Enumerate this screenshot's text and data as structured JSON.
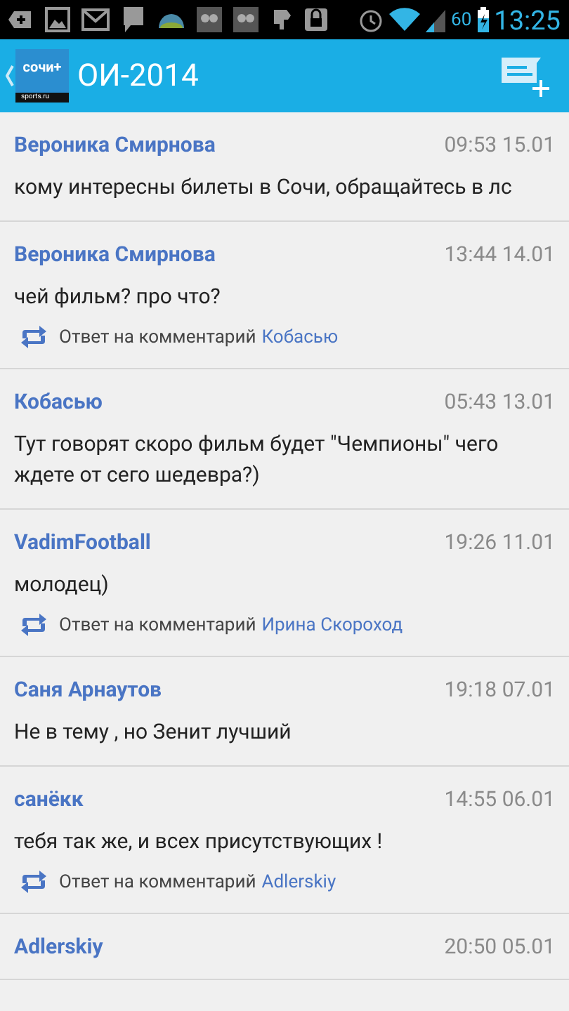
{
  "status_bar": {
    "battery": "60",
    "time": "13:25"
  },
  "app_bar": {
    "logo_text": "сочи+",
    "logo_caption": "sports.ru",
    "title": "ОИ-2014"
  },
  "comments": [
    {
      "author": "Вероника Смирнова",
      "time": "09:53 15.01",
      "text": "кому интересны билеты в Сочи, обращайтесь в лс"
    },
    {
      "author": "Вероника Смирнова",
      "time": "13:44 14.01",
      "text": "чей фильм? про что?",
      "reply": {
        "label": "Ответ на комментарий",
        "target": "Кобасью"
      }
    },
    {
      "author": "Кобасью",
      "time": "05:43 13.01",
      "text": "Тут говорят скоро фильм будет \"Чемпионы\" чего ждете от сего шедевра?)"
    },
    {
      "author": "VadimFootball",
      "time": "19:26 11.01",
      "text": "молодец)",
      "reply": {
        "label": "Ответ на комментарий",
        "target": "Ирина Скороход"
      }
    },
    {
      "author": "Саня Арнаутов",
      "time": "19:18 07.01",
      "text": "Не в тему , но Зенит лучший"
    },
    {
      "author": "санёкк",
      "time": "14:55 06.01",
      "text": "тебя так же, и всех присутствующих !",
      "reply": {
        "label": "Ответ на комментарий",
        "target": "Adlerskiy"
      }
    },
    {
      "author": "Adlerskiy",
      "time": "20:50 05.01"
    }
  ]
}
